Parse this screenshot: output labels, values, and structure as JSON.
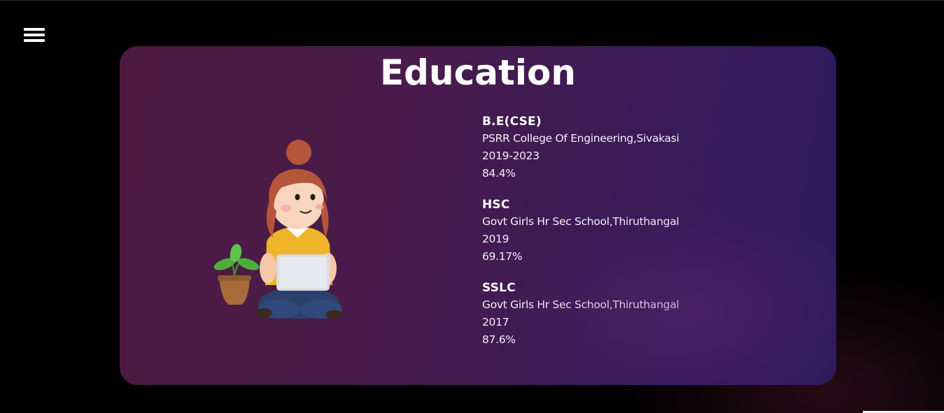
{
  "nav": {
    "menu_icon": "hamburger-icon"
  },
  "section": {
    "title": "Education"
  },
  "illustration": {
    "description_icon": "girl-with-laptop-icon",
    "colors": {
      "hair": "#b5553a",
      "shirt": "#f0b429",
      "jeans": "#2b3f6b",
      "laptop": "#d9dde2",
      "pot": "#a86b3a",
      "leaf": "#4caf3c"
    }
  },
  "education": [
    {
      "degree": "B.E(CSE)",
      "institution": "PSRR College Of Engineering,Sivakasi",
      "years": "2019-2023",
      "score": "84.4%"
    },
    {
      "degree": "HSC",
      "institution": "Govt Girls Hr Sec School,Thiruthangal",
      "years": "2019",
      "score": "69.17%"
    },
    {
      "degree": "SSLC",
      "institution": "Govt Girls Hr Sec School,Thiruthangal",
      "years": "2017",
      "score": "87.6%"
    }
  ],
  "theme": {
    "background": "#000000",
    "card_gradient_start": "#4e1a3f",
    "card_gradient_end": "#2e1a5e",
    "text": "#ffffff"
  }
}
